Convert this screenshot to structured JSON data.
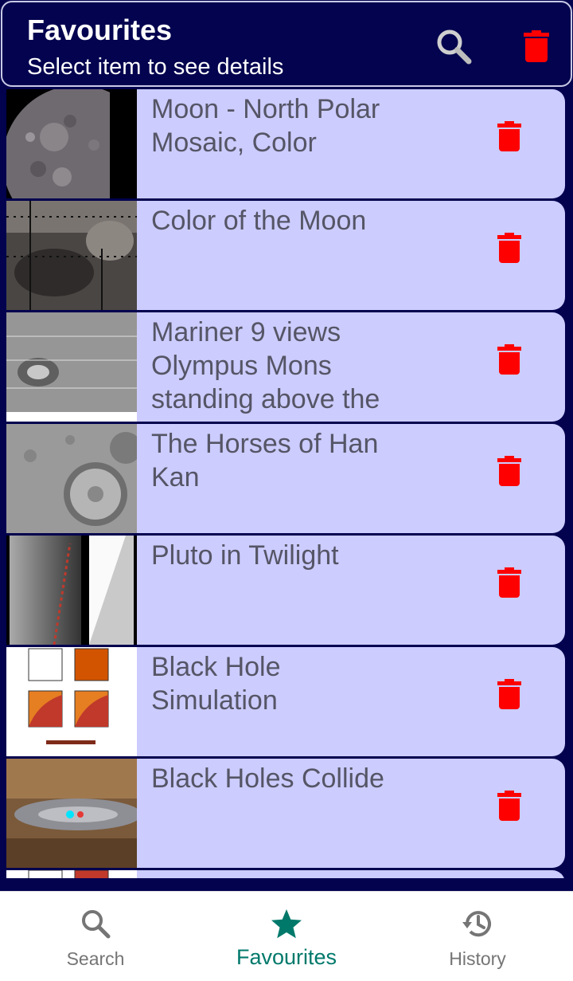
{
  "header": {
    "title": "Favourites",
    "subtitle": "Select item to see details",
    "search_icon": "search-icon",
    "delete_all_icon": "trash-icon"
  },
  "favourites": [
    {
      "title": "Moon - North Polar Mosaic, Color",
      "thumbnail": "moon-north-polar-thumbnail"
    },
    {
      "title": "Color of the Moon",
      "thumbnail": "color-of-moon-thumbnail"
    },
    {
      "title": "Mariner 9 views Olympus Mons standing above the",
      "thumbnail": "olympus-mons-thumbnail"
    },
    {
      "title": "The Horses of Han Kan",
      "thumbnail": "crater-thumbnail"
    },
    {
      "title": "Pluto in Twilight",
      "thumbnail": "pluto-twilight-thumbnail"
    },
    {
      "title": "Black Hole Simulation",
      "thumbnail": "black-hole-simulation-thumbnail"
    },
    {
      "title": "Black Holes Collide",
      "thumbnail": "black-holes-collide-thumbnail"
    }
  ],
  "bottom_nav": {
    "items": [
      {
        "label": "Search",
        "icon": "search-icon",
        "active": false
      },
      {
        "label": "Favourites",
        "icon": "star-icon",
        "active": true
      },
      {
        "label": "History",
        "icon": "history-icon",
        "active": false
      }
    ]
  },
  "colors": {
    "header_bg": "#03034f",
    "card_bg": "#ccccff",
    "delete_red": "#ff0000",
    "active_tab": "#00796b",
    "inactive_tab": "#757575"
  }
}
